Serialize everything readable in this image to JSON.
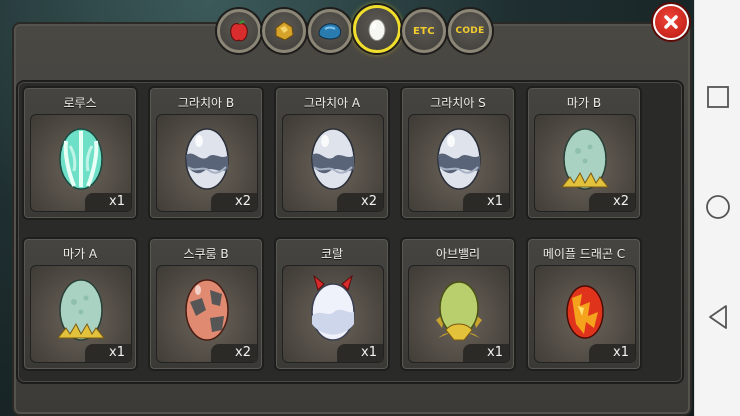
{
  "tabs": [
    {
      "key": "fruit",
      "label": "",
      "icon": "red-fruit-icon",
      "active": false
    },
    {
      "key": "gold",
      "label": "",
      "icon": "gold-nugget-icon",
      "active": false
    },
    {
      "key": "stone",
      "label": "",
      "icon": "blue-stone-icon",
      "active": false
    },
    {
      "key": "egg",
      "label": "",
      "icon": "egg-icon",
      "active": true
    },
    {
      "key": "etc",
      "label": "ETC",
      "icon": "",
      "active": false
    },
    {
      "key": "code",
      "label": "CODE",
      "icon": "",
      "active": false
    }
  ],
  "close_icon": "close-icon",
  "items": [
    {
      "name": "로루스",
      "count": "x1",
      "egg_style": "lorus"
    },
    {
      "name": "그라치아 B",
      "count": "x2",
      "egg_style": "gracia"
    },
    {
      "name": "그라치아 A",
      "count": "x2",
      "egg_style": "gracia"
    },
    {
      "name": "그라치아 S",
      "count": "x1",
      "egg_style": "gracia"
    },
    {
      "name": "마가 B",
      "count": "x2",
      "egg_style": "maga"
    },
    {
      "name": "마가 A",
      "count": "x1",
      "egg_style": "maga"
    },
    {
      "name": "스쿠룸 B",
      "count": "x2",
      "egg_style": "skurum"
    },
    {
      "name": "코랄",
      "count": "x1",
      "egg_style": "coral"
    },
    {
      "name": "아브밸리",
      "count": "x1",
      "egg_style": "abvalley"
    },
    {
      "name": "메이플 드래곤 C",
      "count": "x1",
      "egg_style": "maple"
    }
  ],
  "colors": {
    "tab_active_border": "#f0dd2c",
    "tab_label": "#f2cc2c",
    "close_button": "#d8241a"
  },
  "android_nav": [
    "recent-apps-icon",
    "home-icon",
    "back-icon"
  ]
}
